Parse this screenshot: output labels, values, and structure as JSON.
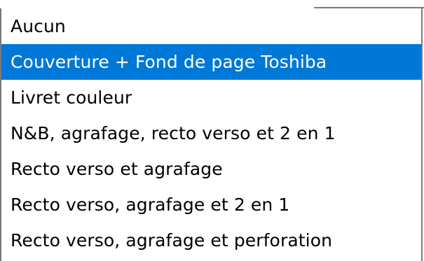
{
  "dropdown": {
    "selected_index": 1,
    "options": [
      {
        "label": "Aucun"
      },
      {
        "label": "Couverture + Fond de page Toshiba"
      },
      {
        "label": "Livret couleur"
      },
      {
        "label": "N&B, agrafage, recto verso et 2 en 1"
      },
      {
        "label": "Recto verso et agrafage"
      },
      {
        "label": "Recto verso, agrafage et 2 en 1"
      },
      {
        "label": "Recto verso, agrafage et perforation"
      }
    ]
  },
  "colors": {
    "selection_background": "#0078d7",
    "selection_text": "#ffffff",
    "border": "#7a7a7a"
  }
}
